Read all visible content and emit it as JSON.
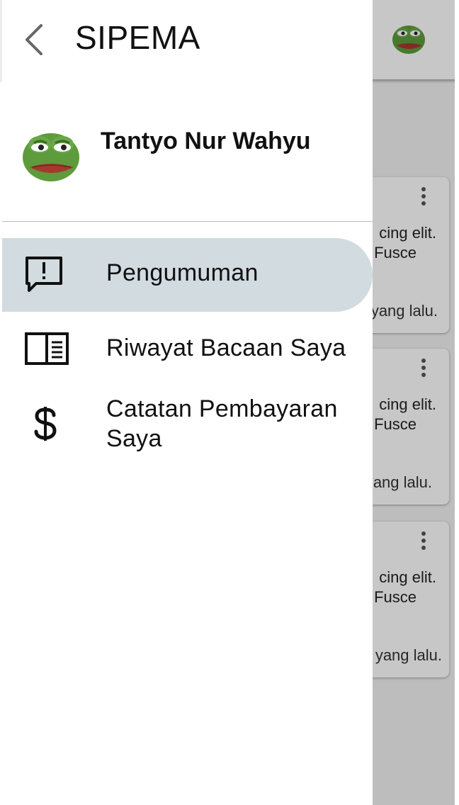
{
  "drawer": {
    "title": "SIPEMA",
    "profile_name": "Tantyo Nur Wahyu",
    "menu": [
      {
        "label": "Pengumuman",
        "icon": "announcement-icon",
        "active": true
      },
      {
        "label": "Riwayat Bacaan Saya",
        "icon": "book-open-icon",
        "active": false
      },
      {
        "label": "Catatan Pembayaran Saya",
        "icon": "dollar-icon",
        "active": false
      }
    ]
  },
  "background_cards": [
    {
      "line1": "cing elit.",
      "line2": "Fusce",
      "line3": "yang lalu."
    },
    {
      "line1": "cing elit.",
      "line2": "Fusce",
      "line3": "ang lalu."
    },
    {
      "line1": "cing elit.",
      "line2": "Fusce",
      "line3": "yang lalu."
    }
  ],
  "colors": {
    "active_item_bg": "#d1dbe0",
    "scrim": "rgba(0,0,0,0.22)"
  }
}
